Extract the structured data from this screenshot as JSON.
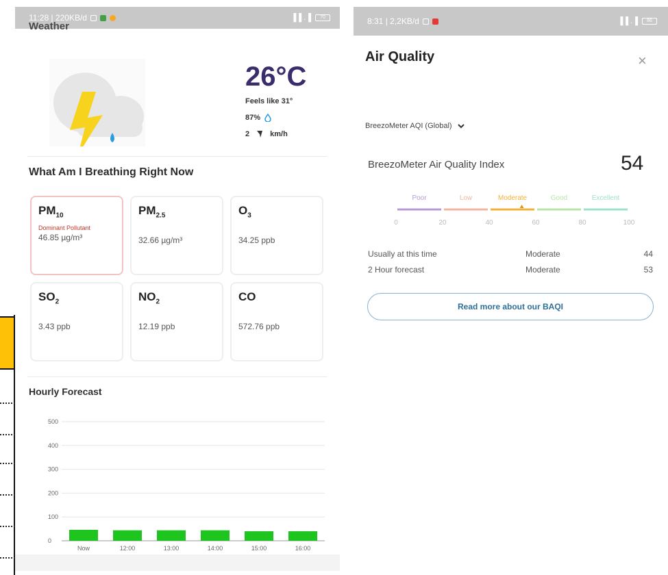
{
  "left_screen": {
    "statusbar": {
      "time_speed": "11:28 | 220KB/d",
      "signal": "▐▐ .▐",
      "battery": "70"
    },
    "overlay_title": "Weather",
    "weather": {
      "temperature": "26°C",
      "feels_like": "Feels like 31°",
      "humidity": "87%",
      "wind_speed": "2",
      "wind_unit": "km/h"
    },
    "breathing_title": "What Am I Breathing Right Now",
    "pollutants": [
      {
        "name": "PM",
        "sub": "10",
        "dominant_label": "Dominant Pollutant",
        "value": "46.85  µg/m³",
        "dominant": true
      },
      {
        "name": "PM",
        "sub": "2.5",
        "value": "32.66  µg/m³"
      },
      {
        "name": "O",
        "sub": "3",
        "value": "34.25  ppb"
      },
      {
        "name": "SO",
        "sub": "2",
        "value": "3.43  ppb"
      },
      {
        "name": "NO",
        "sub": "2",
        "value": "12.19  ppb"
      },
      {
        "name": "CO",
        "sub": "",
        "value": "572.76  ppb"
      }
    ],
    "hourly_title": "Hourly Forecast"
  },
  "chart_data": {
    "type": "bar",
    "title": "",
    "categories": [
      "Now",
      "12:00",
      "13:00",
      "14:00",
      "15:00",
      "16:00"
    ],
    "values": [
      46,
      44,
      44,
      44,
      40,
      40
    ],
    "ylim": [
      0,
      500
    ],
    "yticks": [
      0,
      100,
      200,
      300,
      400,
      500
    ],
    "bar_color": "#1fc51f",
    "grid": true
  },
  "right_screen": {
    "statusbar": {
      "time_speed": "8:31 | 2,2KB/d",
      "battery": "86"
    },
    "title": "Air Quality",
    "close_icon": "×",
    "aqi_selector": "BreezoMeter AQI (Global)",
    "index_label": "BreezoMeter Air Quality Index",
    "index_value": "54",
    "scale": {
      "categories": [
        {
          "label": "Poor",
          "color": "#b79ad6"
        },
        {
          "label": "Low",
          "color": "#f2b6a0"
        },
        {
          "label": "Moderate",
          "color": "#f0b23a"
        },
        {
          "label": "Good",
          "color": "#b9e6a8"
        },
        {
          "label": "Excellent",
          "color": "#9fe0c9"
        }
      ],
      "ticks": [
        "0",
        "20",
        "40",
        "60",
        "80",
        "100"
      ],
      "marker_value": 54
    },
    "rows": [
      {
        "label": "Usually at this time",
        "category": "Moderate",
        "value": "44"
      },
      {
        "label": "2 Hour forecast",
        "category": "Moderate",
        "value": "53"
      }
    ],
    "button_label": "Read more about our BAQI"
  }
}
